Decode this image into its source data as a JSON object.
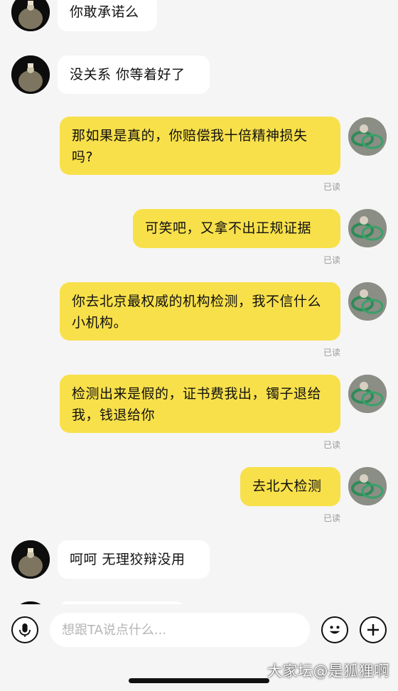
{
  "colors": {
    "background": "#f5f5f5",
    "my_bubble": "#f8e04a",
    "their_bubble": "#ffffff",
    "read_receipt": "#9a9a9a"
  },
  "messages": [
    {
      "side": "left",
      "text": "你敢承诺么"
    },
    {
      "side": "left",
      "text": "没关系 你等着好了"
    },
    {
      "side": "right",
      "text": "那如果是真的，你赔偿我十倍精神损失吗?",
      "status": "已读"
    },
    {
      "side": "right",
      "text": "可笑吧，又拿不出正规证据",
      "status": "已读"
    },
    {
      "side": "right",
      "text": "你去北京最权威的机构检测，我不信什么小机构。",
      "status": "已读"
    },
    {
      "side": "right",
      "text": "检测出来是假的，证书费我出，镯子退给我，钱退给你",
      "status": "已读"
    },
    {
      "side": "right",
      "text": "去北大检测",
      "status": "已读"
    },
    {
      "side": "left",
      "text": "呵呵 无理狡辩没用"
    }
  ],
  "input_bar": {
    "placeholder": "想跟TA说点什么...",
    "voice_icon": "microphone-icon",
    "emoji_icon": "emoji-icon",
    "plus_icon": "plus-icon"
  },
  "watermark": "大家坛@是狐狸啊"
}
